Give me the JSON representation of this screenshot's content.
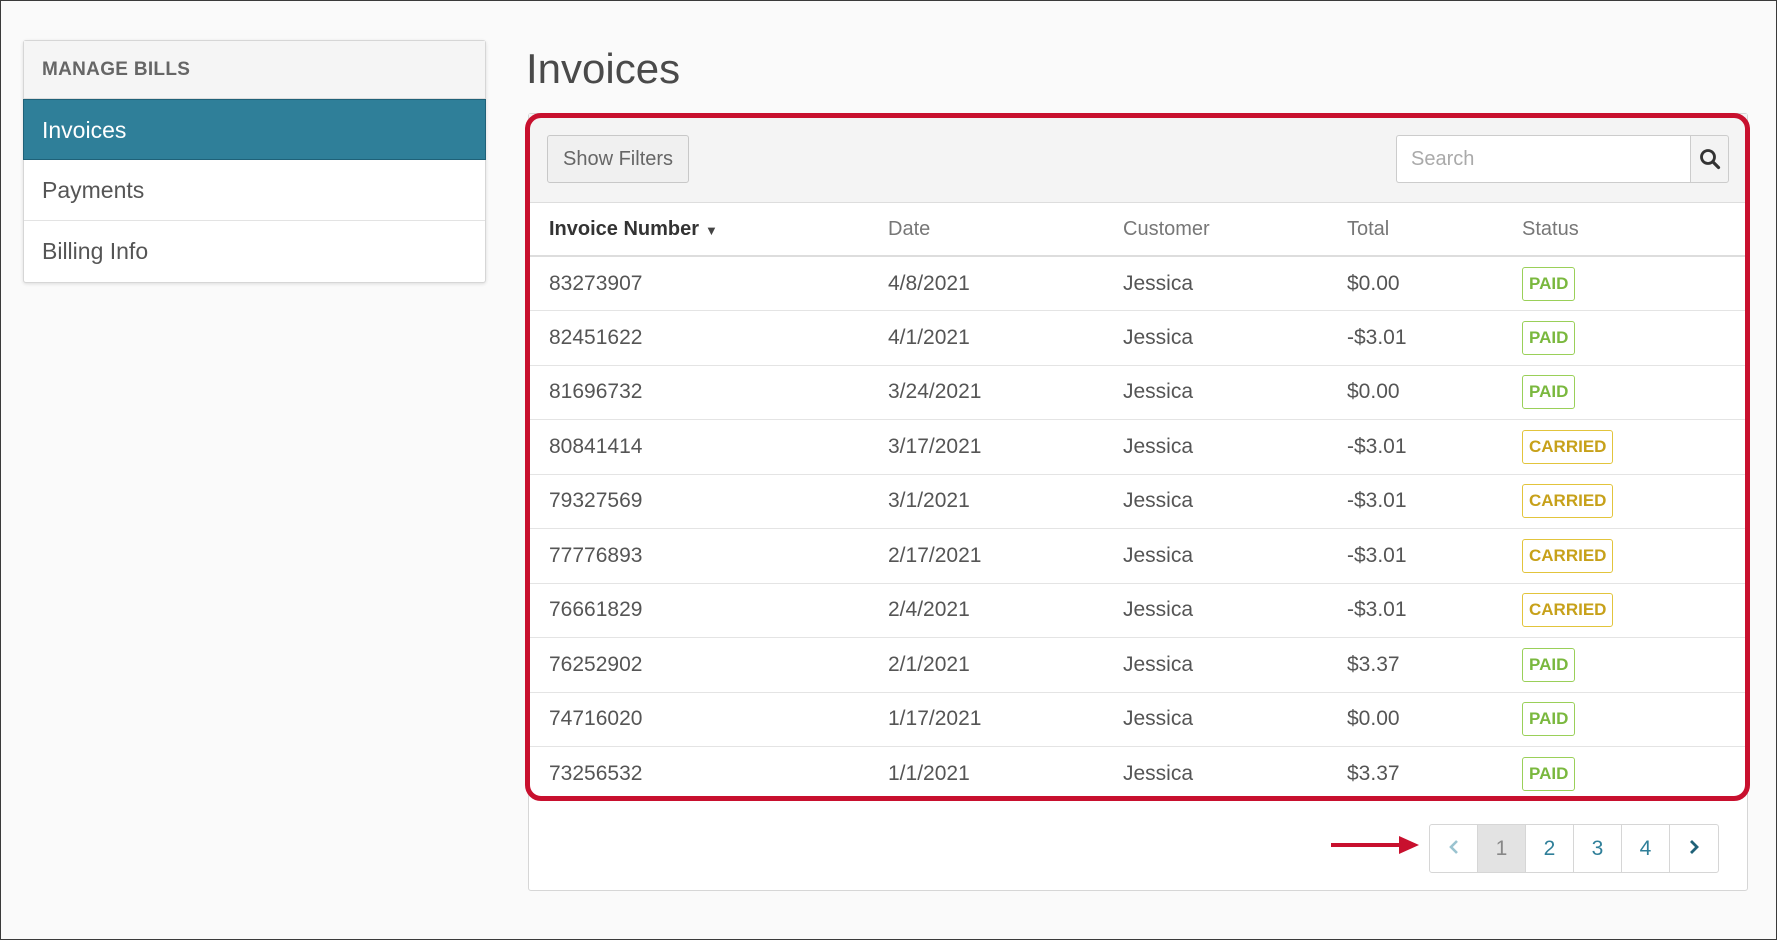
{
  "sidebar": {
    "header": "MANAGE BILLS",
    "items": [
      {
        "label": "Invoices",
        "active": true
      },
      {
        "label": "Payments",
        "active": false
      },
      {
        "label": "Billing Info",
        "active": false
      }
    ]
  },
  "page_title": "Invoices",
  "toolbar": {
    "filters_label": "Show Filters",
    "search_placeholder": "Search",
    "search_icon": "search-icon"
  },
  "table": {
    "columns": [
      "Invoice Number",
      "Date",
      "Customer",
      "Total",
      "Status"
    ],
    "sort_indicator": "▼",
    "rows": [
      {
        "invoice": "83273907",
        "date": "4/8/2021",
        "customer": "Jessica",
        "total": "$0.00",
        "status": "PAID"
      },
      {
        "invoice": "82451622",
        "date": "4/1/2021",
        "customer": "Jessica",
        "total": "-$3.01",
        "status": "PAID"
      },
      {
        "invoice": "81696732",
        "date": "3/24/2021",
        "customer": "Jessica",
        "total": "$0.00",
        "status": "PAID"
      },
      {
        "invoice": "80841414",
        "date": "3/17/2021",
        "customer": "Jessica",
        "total": "-$3.01",
        "status": "CARRIED"
      },
      {
        "invoice": "79327569",
        "date": "3/1/2021",
        "customer": "Jessica",
        "total": "-$3.01",
        "status": "CARRIED"
      },
      {
        "invoice": "77776893",
        "date": "2/17/2021",
        "customer": "Jessica",
        "total": "-$3.01",
        "status": "CARRIED"
      },
      {
        "invoice": "76661829",
        "date": "2/4/2021",
        "customer": "Jessica",
        "total": "-$3.01",
        "status": "CARRIED"
      },
      {
        "invoice": "76252902",
        "date": "2/1/2021",
        "customer": "Jessica",
        "total": "$3.37",
        "status": "PAID"
      },
      {
        "invoice": "74716020",
        "date": "1/17/2021",
        "customer": "Jessica",
        "total": "$0.00",
        "status": "PAID"
      },
      {
        "invoice": "73256532",
        "date": "1/1/2021",
        "customer": "Jessica",
        "total": "$3.37",
        "status": "PAID"
      }
    ]
  },
  "pagination": {
    "prev_icon": "chevron-left-icon",
    "pages": [
      "1",
      "2",
      "3",
      "4"
    ],
    "current": "1",
    "next_icon": "chevron-right-icon"
  },
  "colors": {
    "accent": "#2f7f99",
    "highlight": "#c8102e",
    "paid": "#7ab83e",
    "carried": "#c7a11a"
  }
}
